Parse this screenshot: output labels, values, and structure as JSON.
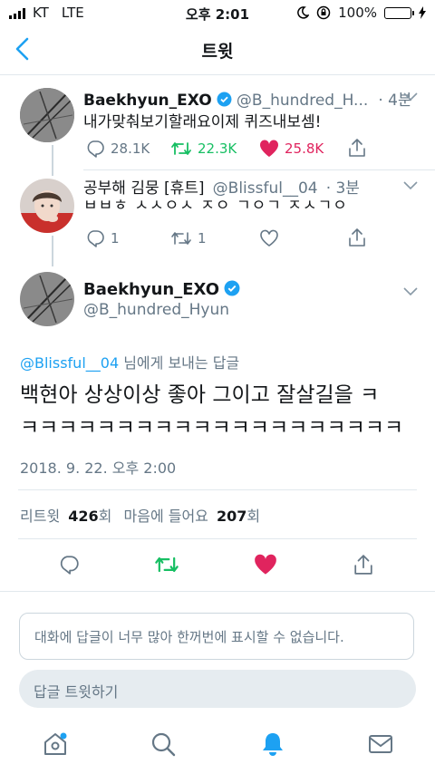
{
  "status_bar": {
    "carrier": "KT",
    "network": "LTE",
    "time": "오후 2:01",
    "battery": "100%",
    "battery_color": "#4cd964"
  },
  "nav": {
    "title": "트윗"
  },
  "tweets": [
    {
      "name": "Baekhyun_EXO",
      "handle": "@B_hundred_H...",
      "time": "· 4분",
      "text": "내가맞춰보기할래요이제 퀴즈내보셈!",
      "replies": "28.1K",
      "retweets": "22.3K",
      "likes": "25.8K"
    },
    {
      "name": "공부해 김뭉 [휴트]",
      "handle": "@Blissful__04",
      "time": "· 3분",
      "text": "ㅂㅂㅎ ㅅㅅㅇㅅ ㅈㅇ ㄱㅇㄱ ㅈㅅㄱㅇ",
      "replies": "1",
      "retweets": "1",
      "likes": ""
    }
  ],
  "main_tweet": {
    "name": "Baekhyun_EXO",
    "handle": "@B_hundred_Hyun",
    "reply_to_handle": "@Blissful__04",
    "reply_to_suffix": " 님에게 보내는 답글",
    "text_line1": "백현아 상상이상 좋아 그이고 잘살길을 ㅋ",
    "text_line2": "ㅋㅋㅋㅋㅋㅋㅋㅋㅋㅋㅋㅋㅋㅋㅋㅋㅋㅋㅋㅋ",
    "timestamp": "2018. 9. 22. 오후 2:00",
    "retweet_label": "리트윗",
    "retweet_count": "426",
    "retweet_unit": "회",
    "like_label": "마음에 들어요",
    "like_count": "207",
    "like_unit": "회"
  },
  "notice": "대화에 답글이 너무 많아 한꺼번에 표시할 수 없습니다.",
  "reply_placeholder": "답글 트윗하기",
  "colors": {
    "accent": "#1da1f2",
    "retweet": "#17bf63",
    "like": "#e0245e",
    "muted": "#657786"
  }
}
